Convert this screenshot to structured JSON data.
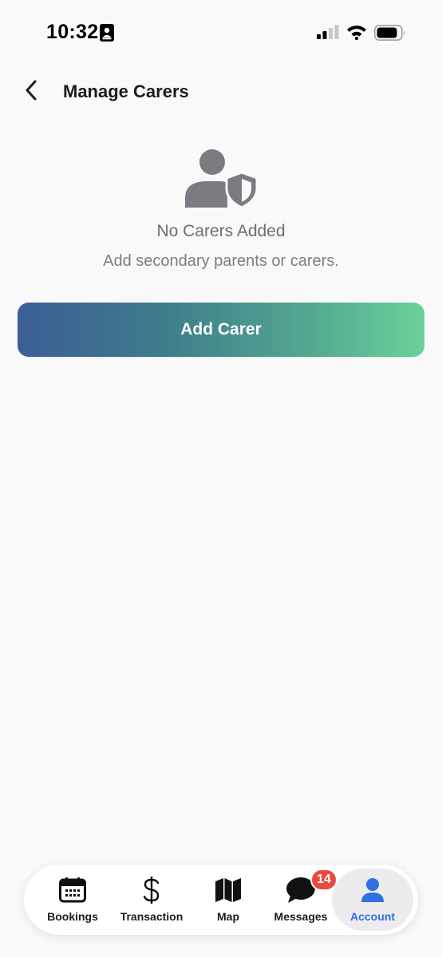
{
  "status_bar": {
    "time": "10:32"
  },
  "header": {
    "title": "Manage Carers",
    "back_icon": "chevron-left-icon"
  },
  "empty_state": {
    "icon": "person-shield-icon",
    "title": "No Carers Added",
    "subtitle": "Add secondary parents or carers."
  },
  "actions": {
    "add_label": "Add Carer",
    "gradient_start": "#3c5f96",
    "gradient_end": "#6ad19a"
  },
  "tab_bar": {
    "items": [
      {
        "label": "Bookings",
        "icon": "calendar-icon",
        "selected": false
      },
      {
        "label": "Transaction",
        "icon": "dollar-icon",
        "selected": false
      },
      {
        "label": "Map",
        "icon": "map-icon",
        "selected": false
      },
      {
        "label": "Messages",
        "icon": "chat-bubble-icon",
        "selected": false,
        "badge": "14"
      },
      {
        "label": "Account",
        "icon": "person-icon",
        "selected": true
      }
    ],
    "accent_color": "#2f6fe0",
    "badge_color": "#e84a3c"
  }
}
